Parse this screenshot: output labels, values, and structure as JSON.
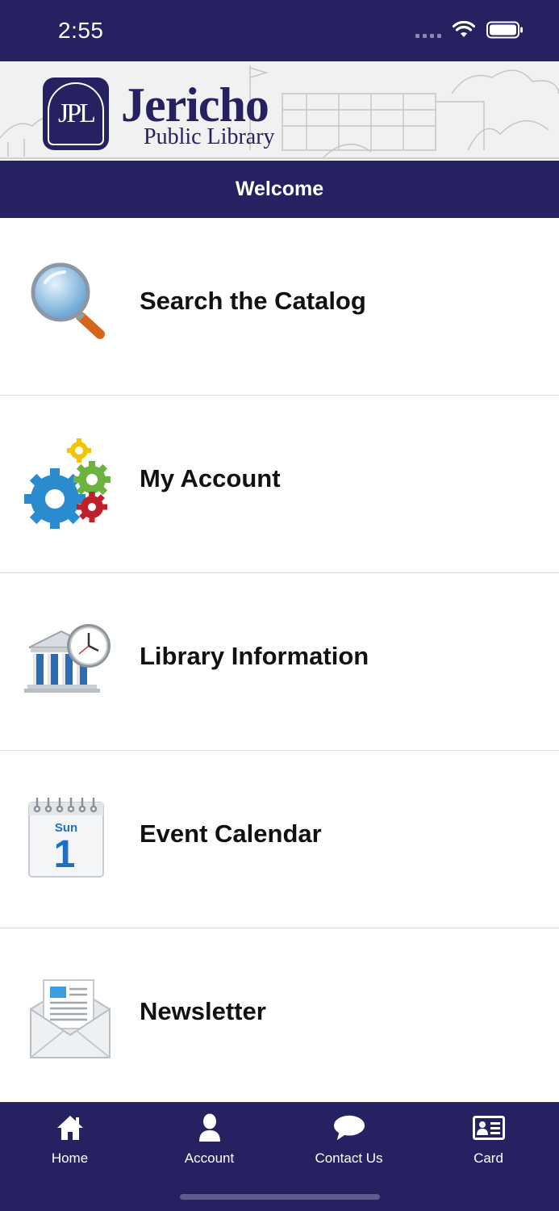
{
  "status_bar": {
    "time": "2:55"
  },
  "header": {
    "logo_initials": "JPL",
    "logo_title": "Jericho",
    "logo_subtitle": "Public Library"
  },
  "page": {
    "title": "Welcome"
  },
  "menu": {
    "items": [
      {
        "label": "Search the Catalog",
        "icon": "magnifier-icon"
      },
      {
        "label": "My Account",
        "icon": "gears-icon"
      },
      {
        "label": "Library Information",
        "icon": "library-clock-icon"
      },
      {
        "label": "Event Calendar",
        "icon": "calendar-icon",
        "calendar_day": "Sun",
        "calendar_date": "1"
      },
      {
        "label": "Newsletter",
        "icon": "envelope-icon"
      }
    ]
  },
  "tab_bar": {
    "tabs": [
      {
        "label": "Home",
        "icon": "home-icon"
      },
      {
        "label": "Account",
        "icon": "person-icon"
      },
      {
        "label": "Contact Us",
        "icon": "chat-bubble-icon"
      },
      {
        "label": "Card",
        "icon": "id-card-icon"
      }
    ]
  },
  "colors": {
    "primary": "#262262",
    "divider": "#dcdcdc"
  }
}
